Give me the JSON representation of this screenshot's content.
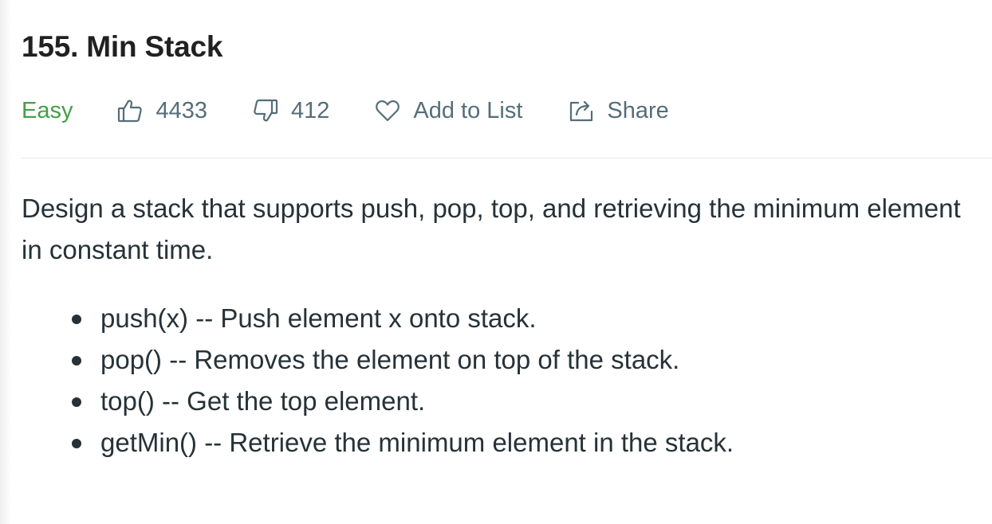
{
  "problem": {
    "title": "155. Min Stack",
    "difficulty": "Easy",
    "likes": "4433",
    "dislikes": "412",
    "add_to_list_label": "Add to List",
    "share_label": "Share",
    "description": "Design a stack that supports push, pop, top, and retrieving the minimum element in constant time.",
    "operations": [
      "push(x) -- Push element x onto stack.",
      "pop() -- Removes the element on top of the stack.",
      "top() -- Get the top element.",
      "getMin() -- Retrieve the minimum element in the stack."
    ]
  },
  "colors": {
    "difficulty_easy": "#43a047",
    "meta_text": "#546e7a",
    "body_text": "#263238",
    "title_text": "#212121",
    "divider": "#e8e8e8"
  },
  "icons": {
    "like": "thumbs-up-icon",
    "dislike": "thumbs-down-icon",
    "add_to_list": "heart-icon",
    "share": "share-icon"
  }
}
